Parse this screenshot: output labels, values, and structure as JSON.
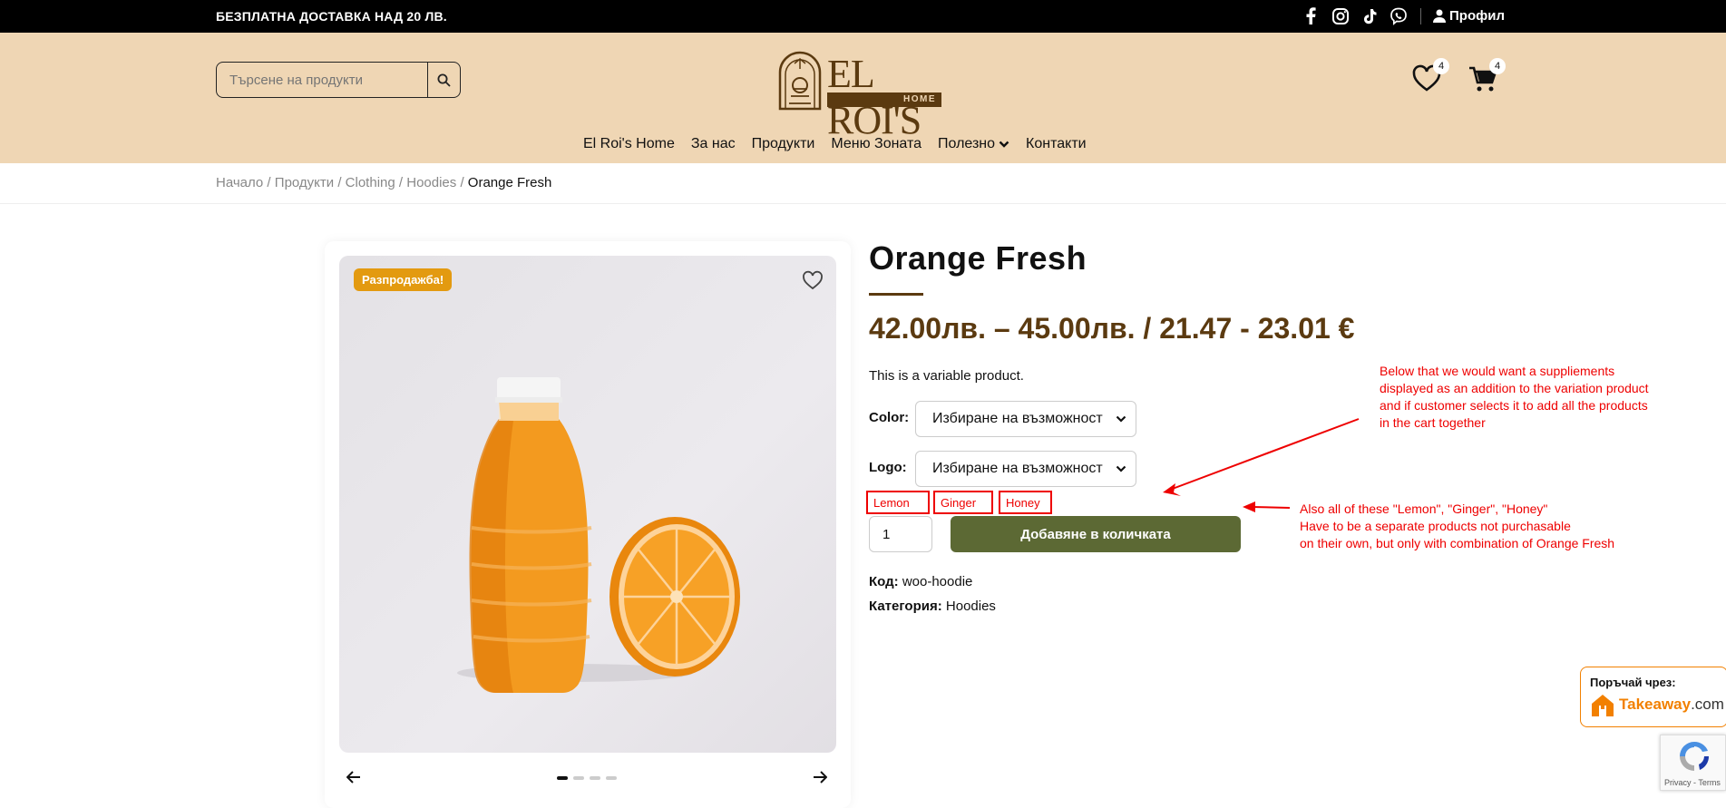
{
  "topbar": {
    "shipping_text": "БЕЗПЛАТНА ДОСТАВКА НАД 20 ЛВ.",
    "profile_label": "Профил"
  },
  "header": {
    "search_placeholder": "Търсене на продукти",
    "logo_text": "EL ROI'S",
    "logo_sub": "HOME",
    "wishlist_count": "4",
    "cart_count": "4"
  },
  "nav": {
    "items": [
      "El Roi's Home",
      "За нас",
      "Продукти",
      "Меню Зоната",
      "Полезно",
      "Контакти"
    ]
  },
  "breadcrumb": {
    "items": [
      "Начало",
      "Продукти",
      "Clothing",
      "Hoodies"
    ],
    "current": "Orange Fresh"
  },
  "gallery": {
    "sale_badge": "Разпродажба!",
    "active_slide": 1,
    "slide_count": 4
  },
  "product": {
    "title": "Orange Fresh",
    "price": "42.00лв. – 45.00лв. / 21.47 - 23.01 €",
    "description": "This is a variable product.",
    "color_label": "Color:",
    "logo_label": "Logo:",
    "select_placeholder": "Избиране на възможност",
    "addons": [
      "Lemon",
      "Ginger",
      "Honey"
    ],
    "quantity": "1",
    "add_to_cart": "Добавяне в количката",
    "sku_label": "Код:",
    "sku": "woo-hoodie",
    "category_label": "Категория:",
    "category": "Hoodies"
  },
  "annotations": {
    "note1": "Below that we would want a suppliements\ndisplayed as an addition to the variation product\nand if customer selects it to add all the products\nin the cart together",
    "note2": "Also all of these \"Lemon\", \"Ginger\", \"Honey\"\nHave to be a separate products not purchasable\non their own, but only with combination of Orange Fresh"
  },
  "takeaway": {
    "label": "Поръчай чрез:",
    "brand": "Takeaway",
    "brand_suffix": ".com"
  },
  "recaptcha": {
    "text": "Privacy - Terms"
  },
  "colors": {
    "header_bg": "#efd6b4",
    "accent_brown": "#5b3a10",
    "button_green": "#5c6934",
    "sale_orange": "#e39a10",
    "annotation_red": "#e00000"
  }
}
